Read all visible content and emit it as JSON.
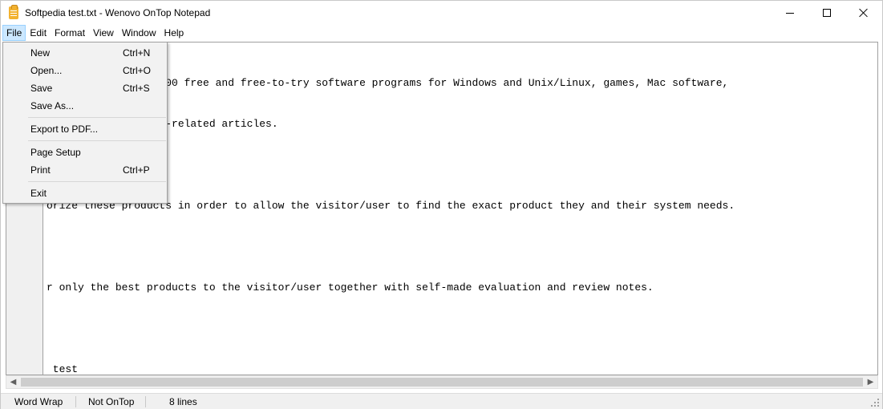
{
  "window": {
    "title": "Softpedia test.txt - Wenovo OnTop Notepad"
  },
  "menubar": {
    "items": [
      "File",
      "Edit",
      "Format",
      "View",
      "Window",
      "Help"
    ],
    "active": "File"
  },
  "file_menu": {
    "items": [
      {
        "label": "New",
        "shortcut": "Ctrl+N"
      },
      {
        "label": "Open...",
        "shortcut": "Ctrl+O"
      },
      {
        "label": "Save",
        "shortcut": "Ctrl+S"
      },
      {
        "label": "Save As...",
        "shortcut": ""
      },
      {
        "label": "Export to PDF...",
        "shortcut": ""
      },
      {
        "label": "Page Setup",
        "shortcut": ""
      },
      {
        "label": "Print",
        "shortcut": "Ctrl+P"
      },
      {
        "label": "Exit",
        "shortcut": ""
      }
    ]
  },
  "editor": {
    "lines": [
      "ary of over 1,300,000 free and free-to-try software programs for Windows and Unix/Linux, games, Mac software,",
      "bile devices and IT-related articles.",
      "",
      "orize these products in order to allow the visitor/user to find the exact product they and their system needs.",
      "",
      "r only the best products to the visitor/user together with self-made evaluation and review notes.",
      "",
      " test"
    ]
  },
  "statusbar": {
    "word_wrap": "Word Wrap",
    "ontop": "Not OnTop",
    "lines": "8 lines"
  },
  "colors": {
    "menu_active_bg": "#cce8ff",
    "menu_active_border": "#99d1ff",
    "app_icon": "#f2b230"
  }
}
